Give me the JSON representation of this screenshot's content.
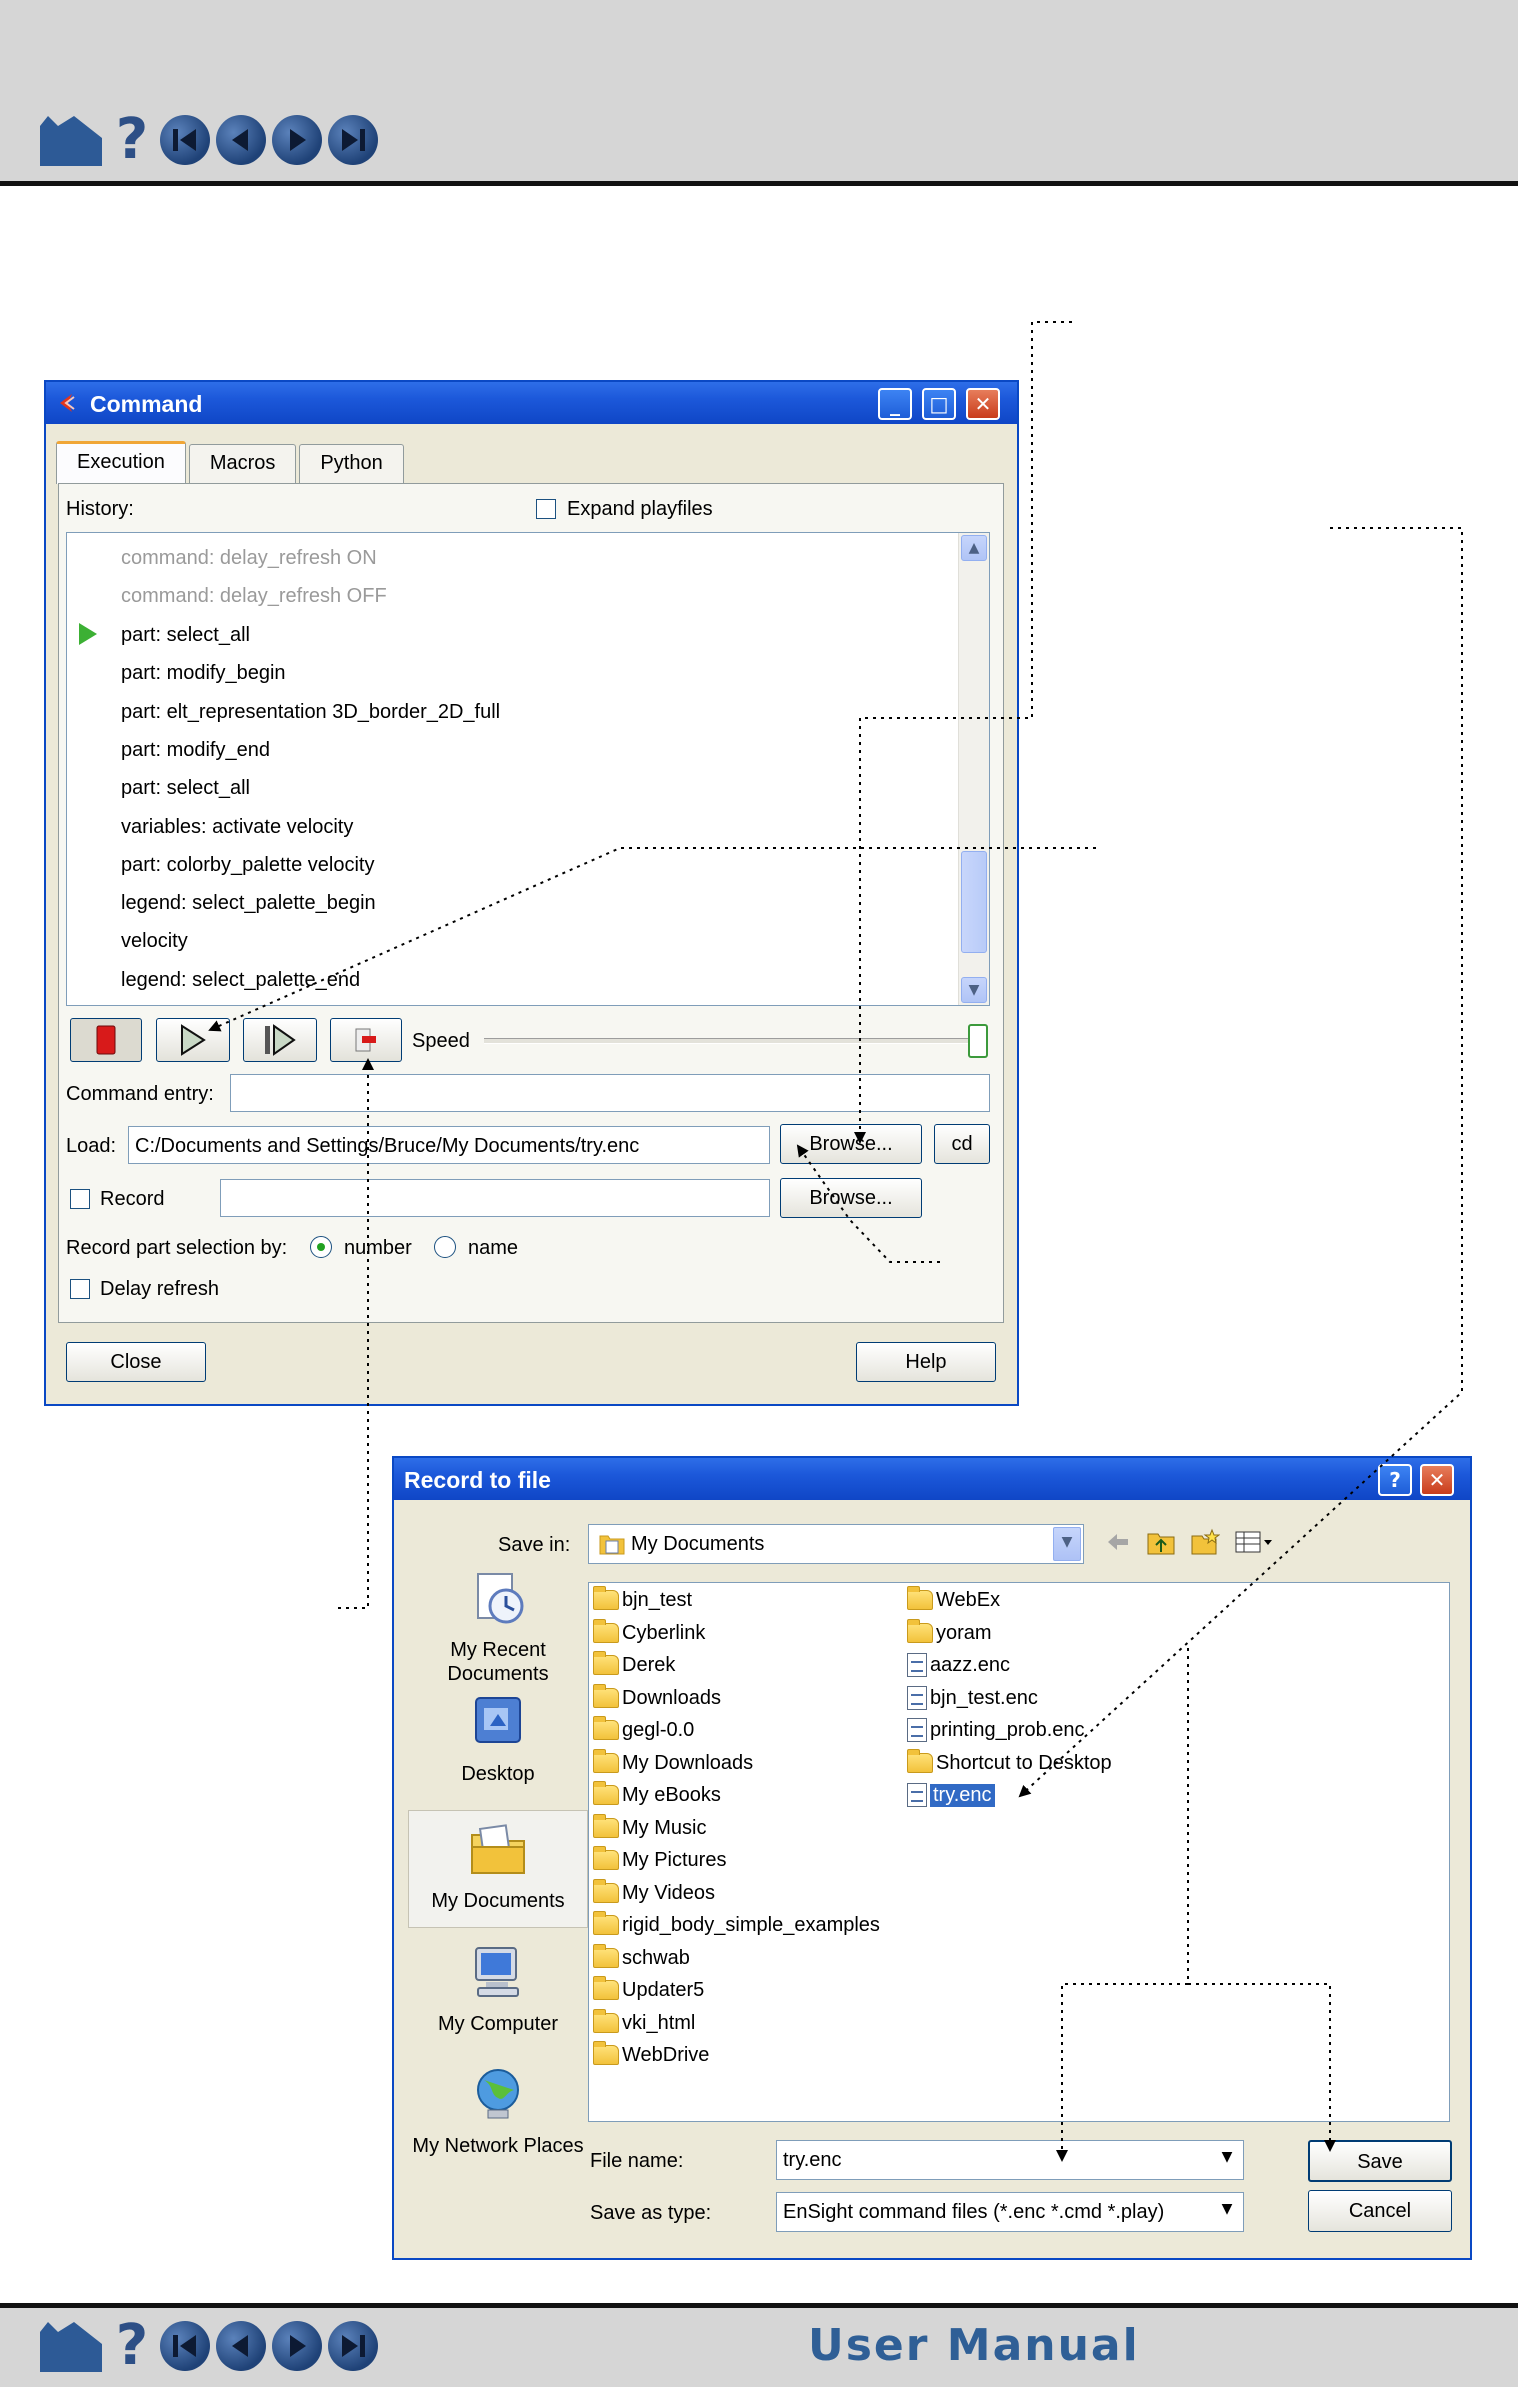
{
  "manual": {
    "footer_title": "User Manual",
    "nav_icons": [
      "home-icon",
      "help-icon",
      "first-page-icon",
      "previous-page-icon",
      "next-page-icon",
      "last-page-icon"
    ],
    "help_glyph": "?"
  },
  "command_window": {
    "title": "Command",
    "tabs": [
      {
        "label": "Execution",
        "active": true
      },
      {
        "label": "Macros",
        "active": false
      },
      {
        "label": "Python",
        "active": false
      }
    ],
    "history_label": "History:",
    "expand_playfiles_label": "Expand playfiles",
    "expand_playfiles_checked": false,
    "history_items": [
      {
        "text": "command: delay_refresh ON",
        "dim": true
      },
      {
        "text": "command: delay_refresh OFF",
        "dim": true
      },
      {
        "text": "part: select_all",
        "dim": false,
        "current": true
      },
      {
        "text": "part: modify_begin",
        "dim": false
      },
      {
        "text": "part: elt_representation 3D_border_2D_full",
        "dim": false
      },
      {
        "text": "part: modify_end",
        "dim": false
      },
      {
        "text": "part: select_all",
        "dim": false
      },
      {
        "text": "variables: activate velocity",
        "dim": false
      },
      {
        "text": "part: colorby_palette velocity",
        "dim": false
      },
      {
        "text": "legend: select_palette_begin",
        "dim": false
      },
      {
        "text": "velocity",
        "dim": false
      },
      {
        "text": "legend: select_palette_end",
        "dim": false
      }
    ],
    "speed_label": "Speed",
    "speed_level_fraction": 1.0,
    "command_entry_label": "Command entry:",
    "command_entry_value": "",
    "load_label": "Load:",
    "load_value": "C:/Documents and Settings/Bruce/My Documents/try.enc",
    "browse_label": "Browse...",
    "cd_label": "cd",
    "record_label": "Record",
    "record_checked": false,
    "record_value": "",
    "record_part_selection_label": "Record part selection by:",
    "radio_number_label": "number",
    "radio_name_label": "name",
    "radio_selected": "number",
    "delay_refresh_label": "Delay refresh",
    "delay_refresh_checked": false,
    "close_label": "Close",
    "help_label": "Help",
    "colors": {
      "titlebar": "#0f46c6",
      "play_indicator": "#3cb034",
      "stop_button": "#d81a1a"
    }
  },
  "record_dialog": {
    "title": "Record to file",
    "help_glyph": "?",
    "save_in_label": "Save in:",
    "save_in_value": "My Documents",
    "places": [
      {
        "label": "My Recent Documents",
        "icon": "recent-documents-icon"
      },
      {
        "label": "Desktop",
        "icon": "desktop-icon"
      },
      {
        "label": "My Documents",
        "icon": "my-documents-icon",
        "active": true
      },
      {
        "label": "My Computer",
        "icon": "my-computer-icon"
      },
      {
        "label": "My Network Places",
        "icon": "network-places-icon"
      }
    ],
    "files_col1": [
      {
        "name": "bjn_test",
        "type": "folder"
      },
      {
        "name": "Cyberlink",
        "type": "folder"
      },
      {
        "name": "Derek",
        "type": "folder"
      },
      {
        "name": "Downloads",
        "type": "folder"
      },
      {
        "name": "gegl-0.0",
        "type": "folder"
      },
      {
        "name": "My Downloads",
        "type": "folder"
      },
      {
        "name": "My eBooks",
        "type": "folder"
      },
      {
        "name": "My Music",
        "type": "folder"
      },
      {
        "name": "My Pictures",
        "type": "folder"
      },
      {
        "name": "My Videos",
        "type": "folder"
      },
      {
        "name": "rigid_body_simple_examples",
        "type": "folder"
      },
      {
        "name": "schwab",
        "type": "folder"
      },
      {
        "name": "Updater5",
        "type": "folder"
      },
      {
        "name": "vki_html",
        "type": "folder"
      },
      {
        "name": "WebDrive",
        "type": "folder"
      }
    ],
    "files_col2": [
      {
        "name": "WebEx",
        "type": "folder"
      },
      {
        "name": "yoram",
        "type": "folder"
      },
      {
        "name": "aazz.enc",
        "type": "file"
      },
      {
        "name": "bjn_test.enc",
        "type": "file"
      },
      {
        "name": "printing_prob.enc",
        "type": "file"
      },
      {
        "name": "Shortcut to Desktop",
        "type": "shortcut"
      },
      {
        "name": "try.enc",
        "type": "file",
        "selected": true
      }
    ],
    "file_name_label": "File name:",
    "file_name_value": "try.enc",
    "save_as_type_label": "Save as type:",
    "save_as_type_value": "EnSight command files (*.enc *.cmd *.play)",
    "save_label": "Save",
    "cancel_label": "Cancel",
    "colors": {
      "selection": "#316ac5"
    }
  }
}
